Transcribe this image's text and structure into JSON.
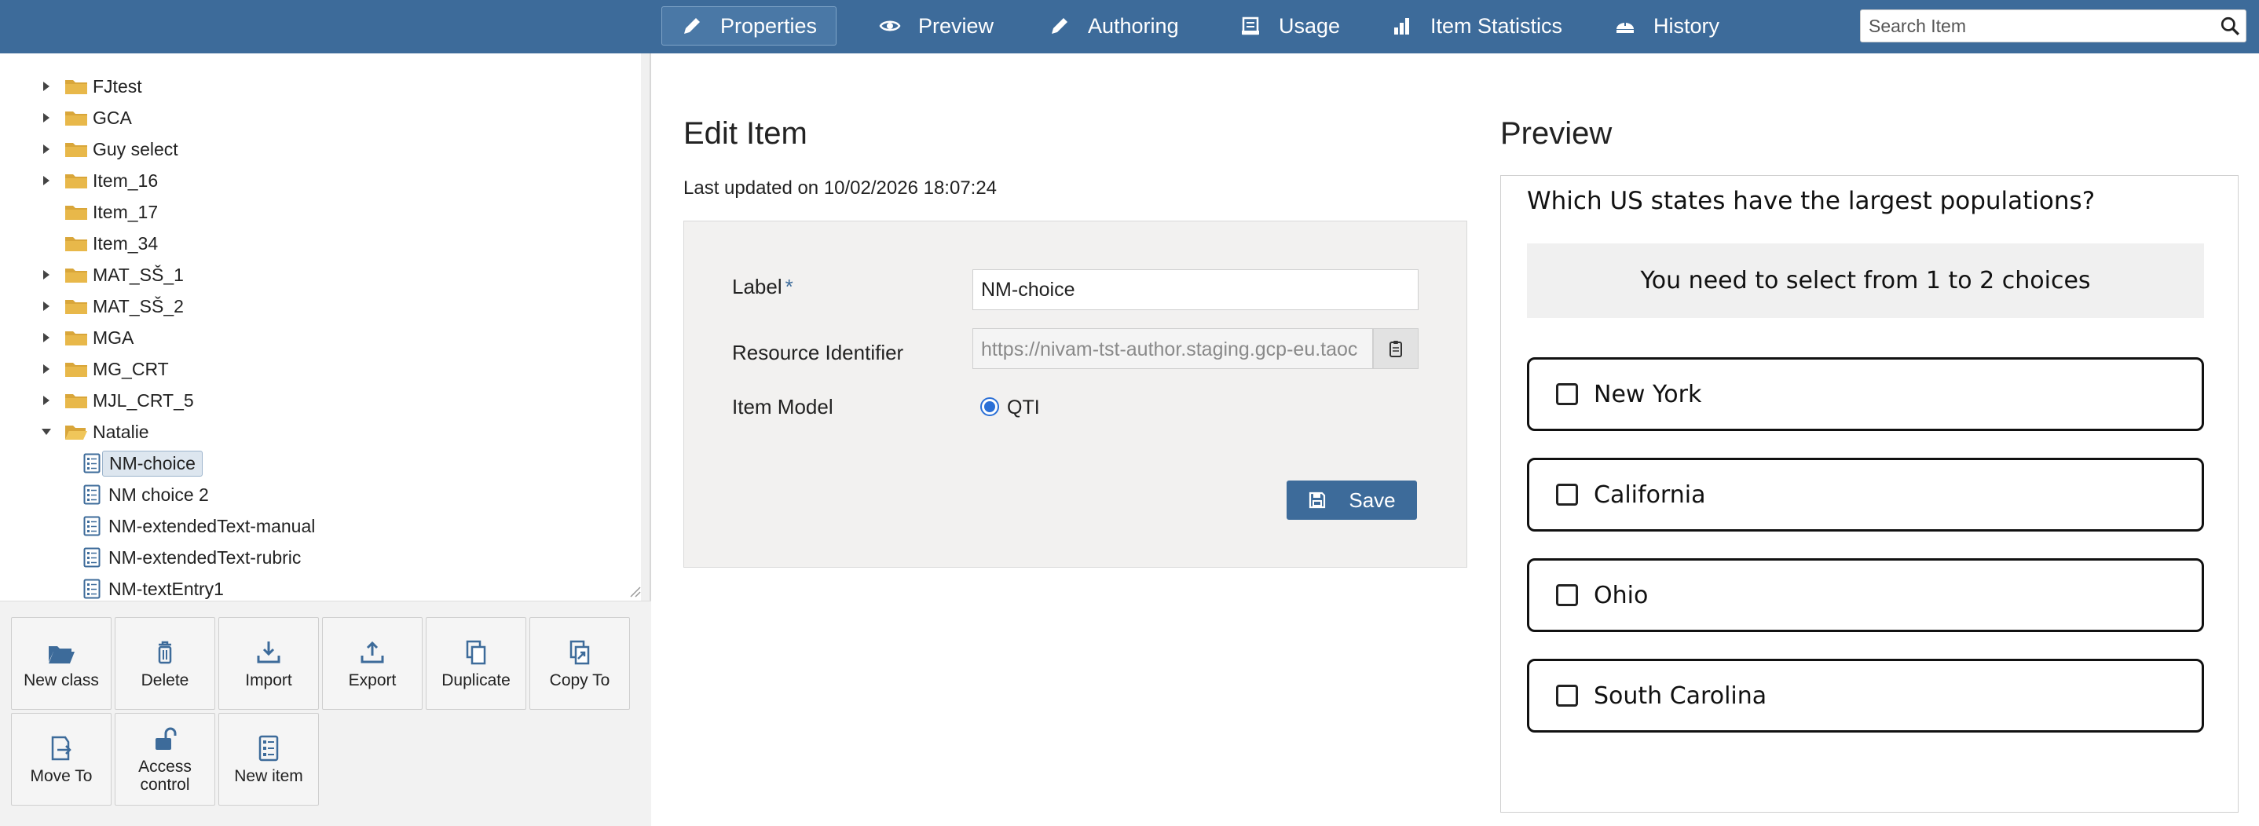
{
  "tree": {
    "items": [
      {
        "label": "FJtest",
        "type": "folder",
        "expandable": true
      },
      {
        "label": "GCA",
        "type": "folder",
        "expandable": true
      },
      {
        "label": "Guy select",
        "type": "folder",
        "expandable": true
      },
      {
        "label": "Item_16",
        "type": "folder",
        "expandable": true
      },
      {
        "label": "Item_17",
        "type": "folder",
        "expandable": false
      },
      {
        "label": "Item_34",
        "type": "folder",
        "expandable": false
      },
      {
        "label": "MAT_SŠ_1",
        "type": "folder",
        "expandable": true
      },
      {
        "label": "MAT_SŠ_2",
        "type": "folder",
        "expandable": true
      },
      {
        "label": "MGA",
        "type": "folder",
        "expandable": true
      },
      {
        "label": "MG_CRT",
        "type": "folder",
        "expandable": true
      },
      {
        "label": "MJL_CRT_5",
        "type": "folder",
        "expandable": true
      },
      {
        "label": "Natalie",
        "type": "folder-open",
        "expandable": true
      },
      {
        "label": "NM-choice",
        "type": "item",
        "selected": true
      },
      {
        "label": "NM choice 2",
        "type": "item"
      },
      {
        "label": "NM-extendedText-manual",
        "type": "item"
      },
      {
        "label": "NM-extendedText-rubric",
        "type": "item"
      },
      {
        "label": "NM-textEntry1",
        "type": "item"
      }
    ]
  },
  "actions": [
    {
      "label": "New class",
      "icon": "folder-open-icon"
    },
    {
      "label": "Delete",
      "icon": "trash-icon"
    },
    {
      "label": "Import",
      "icon": "import-icon"
    },
    {
      "label": "Export",
      "icon": "export-icon"
    },
    {
      "label": "Duplicate",
      "icon": "duplicate-icon"
    },
    {
      "label": "Copy To",
      "icon": "copy-to-icon"
    },
    {
      "label": "Move To",
      "icon": "move-to-icon"
    },
    {
      "label": "Access control",
      "icon": "lock-open-icon"
    },
    {
      "label": "New item",
      "icon": "item-icon"
    }
  ],
  "nav": {
    "tabs": [
      {
        "label": "Properties",
        "icon": "pencil-icon",
        "active": true
      },
      {
        "label": "Preview",
        "icon": "eye-icon"
      },
      {
        "label": "Authoring",
        "icon": "pencil-icon"
      },
      {
        "label": "Usage",
        "icon": "usage-icon"
      },
      {
        "label": "Item Statistics",
        "icon": "bar-chart-icon"
      },
      {
        "label": "History",
        "icon": "history-icon"
      }
    ],
    "search_placeholder": "Search Item"
  },
  "edit": {
    "title": "Edit Item",
    "last_updated": "Last updated on 10/02/2026 18:07:24",
    "label_field": "Label",
    "required_mark": "*",
    "label_value": "NM-choice",
    "resource_field": "Resource Identifier",
    "resource_value": "https://nivam-tst-author.staging.gcp-eu.taoc",
    "model_field": "Item Model",
    "model_value": "QTI",
    "save_label": "Save"
  },
  "preview": {
    "title": "Preview",
    "question": "Which US states have the largest populations?",
    "hint": "You need to select from 1 to 2 choices",
    "choices": [
      "New York",
      "California",
      "Ohio",
      "South Carolina"
    ]
  },
  "colors": {
    "brand": "#3d6b9a",
    "radio": "#2a6fd6"
  }
}
